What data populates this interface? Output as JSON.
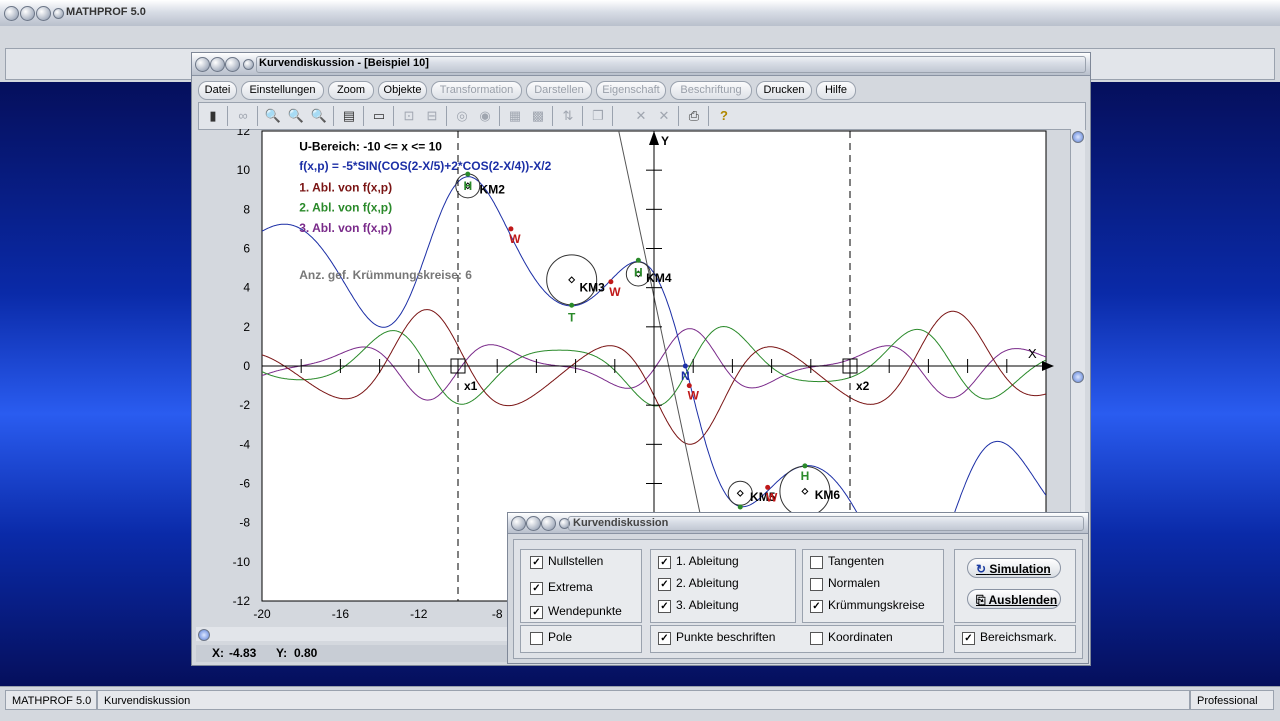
{
  "app": {
    "title": "MATHPROF 5.0"
  },
  "graph_window": {
    "title": "Kurvendiskussion - [Beispiel 10]",
    "menu": [
      {
        "label": "Datei",
        "enabled": true
      },
      {
        "label": "Einstellungen",
        "enabled": true
      },
      {
        "label": "Zoom",
        "enabled": true
      },
      {
        "label": "Objekte",
        "enabled": true
      },
      {
        "label": "Transformation",
        "enabled": false
      },
      {
        "label": "Darstellen",
        "enabled": false
      },
      {
        "label": "Eigenschaft",
        "enabled": false
      },
      {
        "label": "Beschriftung",
        "enabled": false
      },
      {
        "label": "Drucken",
        "enabled": true
      },
      {
        "label": "Hilfe",
        "enabled": true
      }
    ],
    "coords": {
      "x_label": "X:",
      "x_value": "-4.83",
      "y_label": "Y:",
      "y_value": "0.80"
    }
  },
  "plot": {
    "y_axis_name": "Y",
    "x_axis_name": "X",
    "x_ticks": [
      "-20",
      "-16",
      "-12",
      "-8"
    ],
    "y_ticks": [
      "12",
      "10",
      "8",
      "6",
      "4",
      "2",
      "0",
      "-2",
      "-4",
      "-6",
      "-8",
      "-10",
      "-12"
    ],
    "info": {
      "range": "U-Bereich: -10 <= x <= 10",
      "function": "f(x,p) = -5*SIN(COS(2-X/5)+2*COS(2-X/4))-X/2",
      "deriv1": "1. Abl. von f(x,p)",
      "deriv2": "2. Abl. von f(x,p)",
      "deriv3": "3. Abl. von f(x,p)",
      "circles": "Anz. gef. Krümmungskreise: 6"
    },
    "labels": {
      "km2": "KM2",
      "km3": "KM3",
      "km4": "KM4",
      "km5": "KM5",
      "km6": "KM6",
      "x1": "x1",
      "x2": "x2",
      "h": "H",
      "t": "T",
      "w": "W",
      "n": "N"
    },
    "colors": {
      "f": "#1c2fa6",
      "d1": "#7a1414",
      "d2": "#2a8a2a",
      "d3": "#7a2a8a",
      "w": "#c01818"
    }
  },
  "chart_data": {
    "type": "line",
    "function": "f(x,p) = -5*SIN(COS(2-X/5)+2*COS(2-X/4))-X/2",
    "xlim": [
      -20,
      20
    ],
    "ylim": [
      -12,
      12
    ],
    "x_tick_labels": [
      "-20",
      "-16",
      "-12",
      "-8"
    ],
    "y_tick_labels": [
      "12",
      "10",
      "8",
      "6",
      "4",
      "2",
      "0",
      "-2",
      "-4",
      "-6",
      "-8",
      "-10",
      "-12"
    ],
    "grid": false,
    "series": [
      {
        "name": "f(x,p)",
        "color": "#1c2fa6"
      },
      {
        "name": "1. Abl. von f(x,p)",
        "color": "#7a1414"
      },
      {
        "name": "2. Abl. von f(x,p)",
        "color": "#2a8a2a"
      },
      {
        "name": "3. Abl. von f(x,p)",
        "color": "#7a2a8a"
      }
    ],
    "range_markers": [
      -10,
      10
    ],
    "curvature_circles": 6
  },
  "panel": {
    "title": "Kurvendiskussion",
    "nullstellen": {
      "label": "Nullstellen",
      "checked": true
    },
    "extrema": {
      "label": "Extrema",
      "checked": true
    },
    "wendepunkte": {
      "label": "Wendepunkte",
      "checked": true
    },
    "pole": {
      "label": "Pole",
      "checked": false
    },
    "abl1": {
      "label": "1. Ableitung",
      "checked": true
    },
    "abl2": {
      "label": "2. Ableitung",
      "checked": true
    },
    "abl3": {
      "label": "3. Ableitung",
      "checked": true
    },
    "punkte": {
      "label": "Punkte beschriften",
      "checked": true
    },
    "tangenten": {
      "label": "Tangenten",
      "checked": false
    },
    "normalen": {
      "label": "Normalen",
      "checked": false
    },
    "kruemmung": {
      "label": "Krümmungskreise",
      "checked": true
    },
    "koordinaten": {
      "label": "Koordinaten",
      "checked": false
    },
    "bereich": {
      "label": "Bereichsmark.",
      "checked": true
    },
    "simulation_label": "Simulation",
    "ausblenden_label": "Ausblenden"
  },
  "status": {
    "app": "MATHPROF 5.0",
    "module": "Kurvendiskussion",
    "edition": "Professional"
  }
}
